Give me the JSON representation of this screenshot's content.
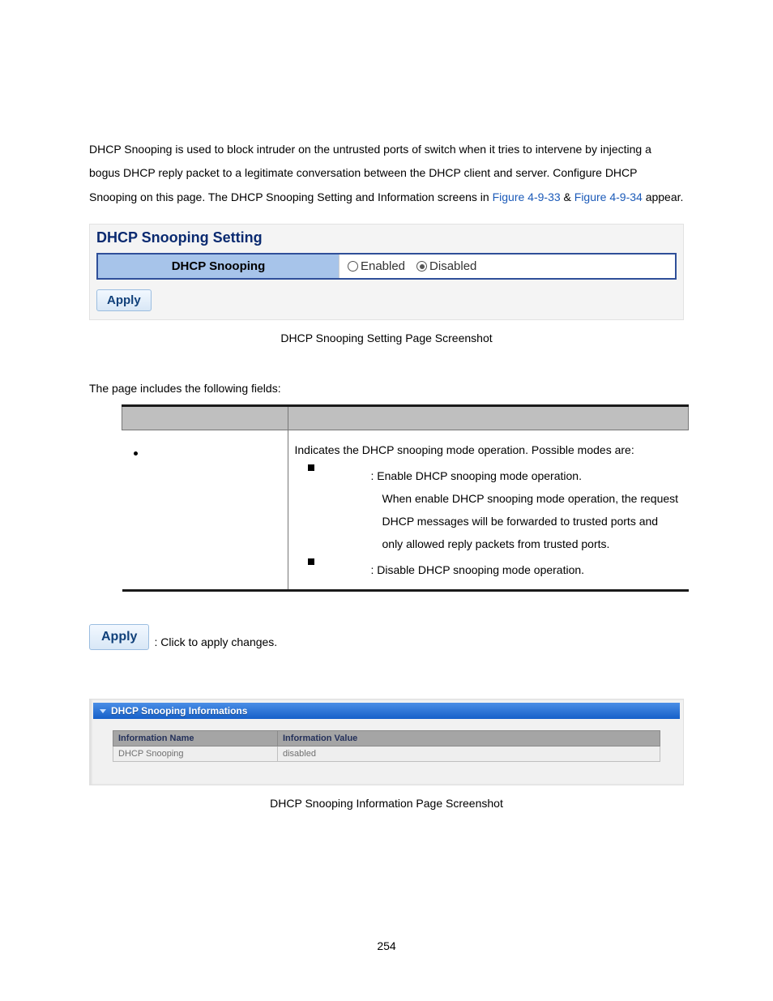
{
  "intro": {
    "part1": "DHCP Snooping is used to block intruder on the untrusted ports of switch when it tries to intervene by injecting a bogus DHCP reply packet to a legitimate conversation between the DHCP client and server. Configure DHCP Snooping on this page. The DHCP Snooping Setting and Information screens in ",
    "link1": "Figure 4-9-33",
    "amp": " & ",
    "link2": "Figure 4-9-34",
    "part2": " appear."
  },
  "settings": {
    "panel_title": "DHCP Snooping Setting",
    "row_label": "DHCP Snooping",
    "radio_enabled": "Enabled",
    "radio_disabled": "Disabled",
    "apply_btn": "Apply"
  },
  "caption1": "DHCP Snooping Setting Page Screenshot",
  "fields_intro": "The page includes the following fields:",
  "fields": {
    "desc_line": "Indicates the DHCP snooping mode operation. Possible modes are:",
    "enable_text": ": Enable DHCP snooping mode operation.",
    "enable_extra": "When enable DHCP snooping mode operation, the request DHCP messages will be forwarded to trusted ports and only allowed reply packets from trusted ports.",
    "disable_text": ": Disable DHCP snooping mode operation."
  },
  "apply_desc": {
    "btn": "Apply",
    "text": ": Click to apply changes."
  },
  "info_panel": {
    "header": "DHCP Snooping Informations",
    "col_name": "Information Name",
    "col_value": "Information Value",
    "row_name": "DHCP Snooping",
    "row_value": "disabled"
  },
  "caption2": "DHCP Snooping Information Page Screenshot",
  "page_number": "254"
}
